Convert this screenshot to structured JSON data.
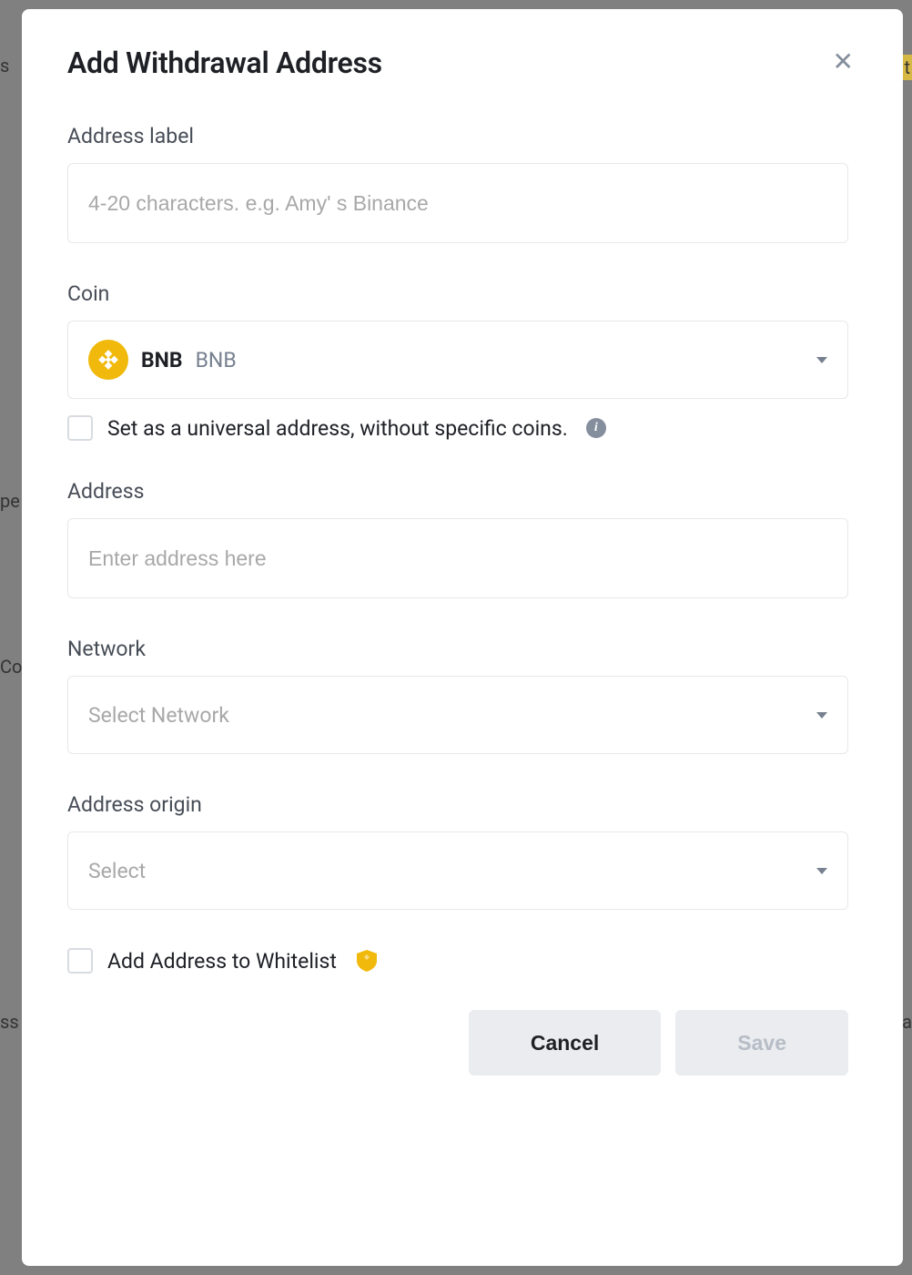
{
  "modal": {
    "title": "Add Withdrawal Address",
    "close_label": "×",
    "address_label": {
      "label": "Address label",
      "placeholder": "4-20 characters. e.g. Amy' s Binance"
    },
    "coin": {
      "label": "Coin",
      "selected_symbol": "BNB",
      "selected_name": "BNB",
      "universal_checkbox_label": "Set as a universal address, without specific coins."
    },
    "address": {
      "label": "Address",
      "placeholder": "Enter address here"
    },
    "network": {
      "label": "Network",
      "placeholder": "Select Network"
    },
    "address_origin": {
      "label": "Address origin",
      "placeholder": "Select"
    },
    "whitelist": {
      "label": "Add Address to Whitelist"
    },
    "buttons": {
      "cancel": "Cancel",
      "save": "Save"
    }
  }
}
